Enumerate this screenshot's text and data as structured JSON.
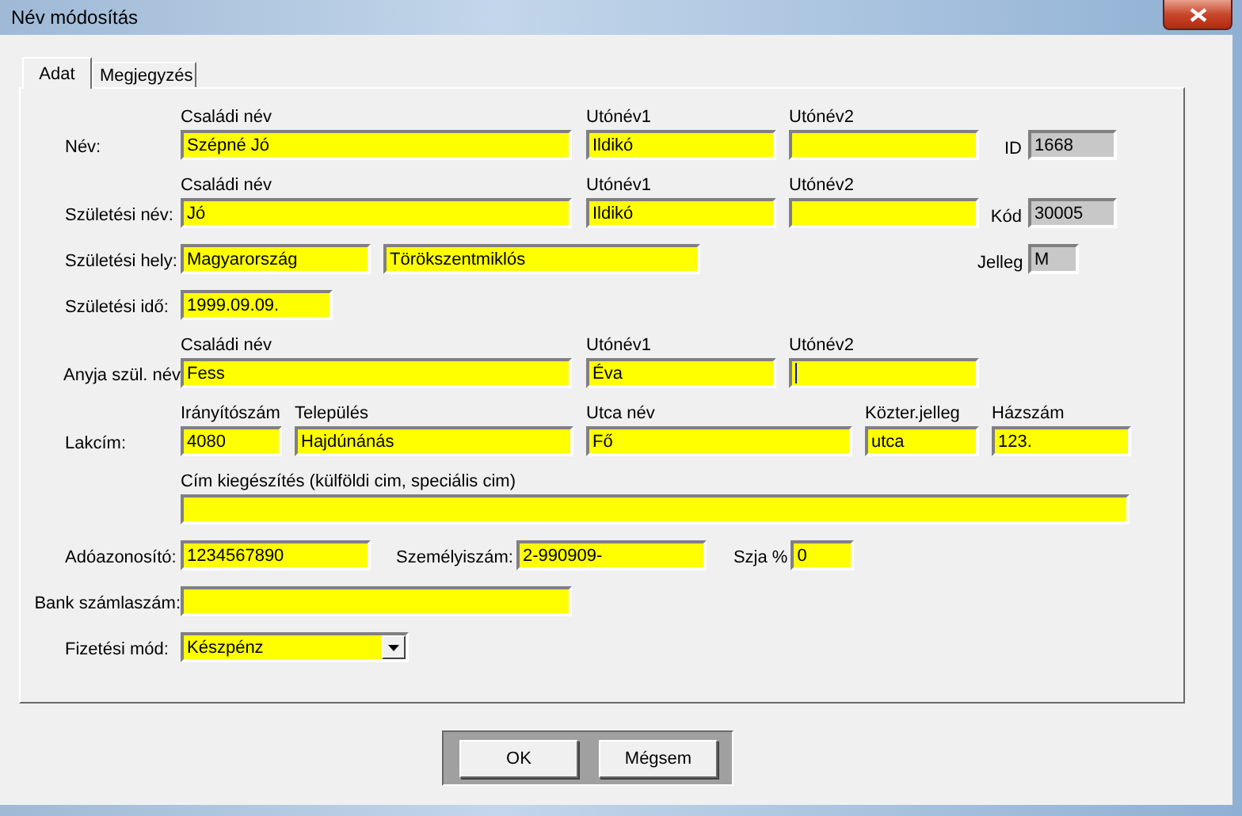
{
  "window": {
    "title": "Név módosítás"
  },
  "tabs": [
    {
      "label": "Adat",
      "selected": true
    },
    {
      "label": "Megjegyzés",
      "selected": false
    }
  ],
  "rows": [
    {
      "label": "Név:",
      "fields": [
        {
          "caption": "Családi név",
          "value": "Szépné Jó"
        },
        {
          "caption": "Utónév1",
          "value": "Ildikó"
        },
        {
          "caption": "Utónév2"
        }
      ],
      "side": {
        "label": "ID",
        "value": "1668"
      }
    },
    {
      "label": "Születési név:",
      "fields": [
        {
          "caption": "Családi név",
          "value": "Jó"
        },
        {
          "caption": "Utónév1",
          "value": "Ildikó"
        },
        {
          "caption": "Utónév2"
        }
      ],
      "side": {
        "label": "Kód",
        "value": "30005"
      }
    },
    {
      "label": "Születési hely:",
      "fields": [
        {
          "value": "Magyarország"
        },
        {
          "value": "Törökszentmiklós"
        }
      ],
      "side": {
        "label": "Jelleg",
        "value": "M"
      }
    },
    {
      "label": "Születési idő:",
      "fields": [
        {
          "value": "1999.09.09."
        }
      ]
    },
    {
      "label": "Anyja szül. név",
      "fields": [
        {
          "caption": "Családi név",
          "value": "Fess"
        },
        {
          "caption": "Utónév1",
          "value": "Éva"
        },
        {
          "caption": "Utónév2",
          "focused": true
        }
      ]
    },
    {
      "label": "Lakcím:",
      "fields": [
        {
          "caption": "Irányítószám",
          "value": "4080"
        },
        {
          "caption": "Település",
          "value": "Hajdúnánás"
        },
        {
          "caption": "Utca név",
          "value": "Fő"
        },
        {
          "caption": "Közter.jelleg",
          "value": "utca"
        },
        {
          "caption": "Házszám",
          "value": "123."
        }
      ]
    },
    {
      "fields": [
        {
          "caption": "Cím kiegészítés (külföldi cim, speciális cim)"
        }
      ]
    },
    {
      "label": "Adóazonosító:",
      "fields": [
        {
          "value": "1234567890"
        },
        {
          "label": "Személyiszám:",
          "value": "2-990909-"
        },
        {
          "label": "Szja %",
          "value": "0"
        }
      ]
    },
    {
      "label": "Bank számlaszám:",
      "fields": [
        {
          "kind": "text"
        }
      ]
    },
    {
      "label": "Fizetési mód:",
      "fields": [
        {
          "kind": "combo",
          "value": "Készpénz"
        }
      ]
    }
  ],
  "buttons": [
    "OK",
    "Mégsem"
  ]
}
